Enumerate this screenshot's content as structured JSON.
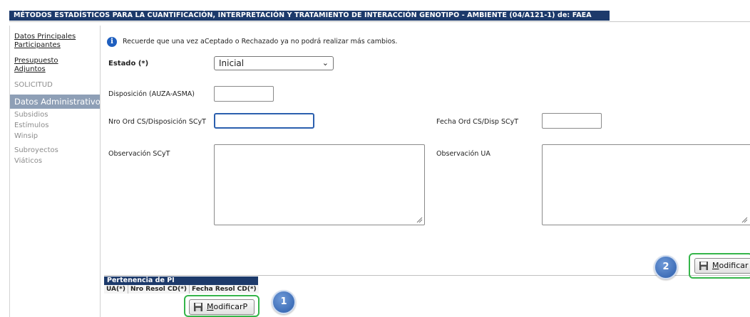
{
  "title": "MÉTODOS ESTADÍSTICOS PARA LA CUANTIFICACIÓN, INTERPRETACIÓN Y TRATAMIENTO DE INTERACCIÓN GENOTIPO - AMBIENTE (04/A121-1) de: FAEA",
  "sidebar": {
    "links": [
      "Datos Principales",
      "Participantes",
      "Presupuesto",
      "Adjuntos"
    ],
    "solicitud": "SOLICITUD",
    "active": "Datos Administrativos",
    "grey": [
      "Subsidios",
      "Estímulos",
      "Winsip",
      "Subroyectos",
      "Viáticos"
    ]
  },
  "notice": "Recuerde que una vez aCeptado o Rechazado ya no podrá realizar más cambios.",
  "form": {
    "estado_label": "Estado (*)",
    "estado_value": "Inicial",
    "disposicion_label": "Disposición (AUZA-ASMA)",
    "disposicion_value": "",
    "nro_ord_label": "Nro Ord CS/Disposición SCyT",
    "nro_ord_value": "",
    "fecha_ord_label": "Fecha Ord CS/Disp SCyT",
    "fecha_ord_value": "",
    "obs_scyt_label": "Observación SCyT",
    "obs_ua_label": "Observación UA"
  },
  "pertenencia": {
    "title": "Pertenencia de PI",
    "columns": [
      "UA(*)",
      "Nro Resol CD(*)",
      "Fecha Resol CD(*)"
    ]
  },
  "buttons": {
    "modificar_p_prefix": "M",
    "modificar_p_rest": "odificarP",
    "modificar_prefix": "M",
    "modificar_rest": "odificar"
  },
  "badges": {
    "one": "1",
    "two": "2"
  },
  "colors": {
    "header": "#1d3a6b",
    "active_sidebar": "#8e9fb6",
    "highlight": "#35b54a",
    "badge": "#3f6fb8"
  },
  "icons": {
    "info": "info-icon",
    "save": "floppy-disk-icon",
    "select": "chevron-down-icon"
  }
}
